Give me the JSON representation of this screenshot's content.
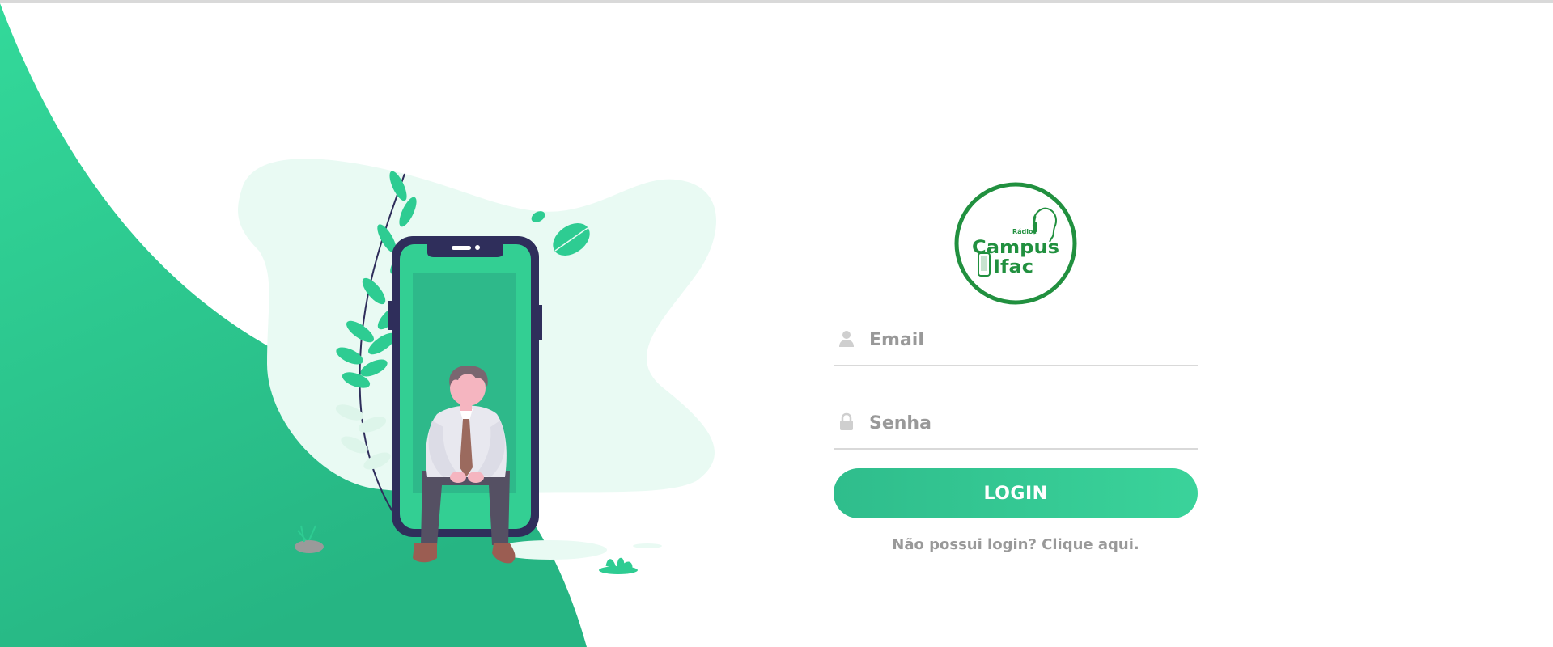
{
  "logo": {
    "line1": "Rádio",
    "line2": "Campus",
    "line3": "Ifac"
  },
  "form": {
    "email_placeholder": "Email",
    "password_placeholder": "Senha",
    "login_label": "LOGIN",
    "signup_link": "Não possui login? Clique aqui."
  },
  "colors": {
    "primary": "#2ecc92",
    "primary_dark": "#27ae7f",
    "logo_green": "#21903f",
    "phone_frame": "#2f2e5b",
    "text_gray": "#999999"
  },
  "icons": {
    "email_icon": "user-icon",
    "password_icon": "lock-icon"
  }
}
